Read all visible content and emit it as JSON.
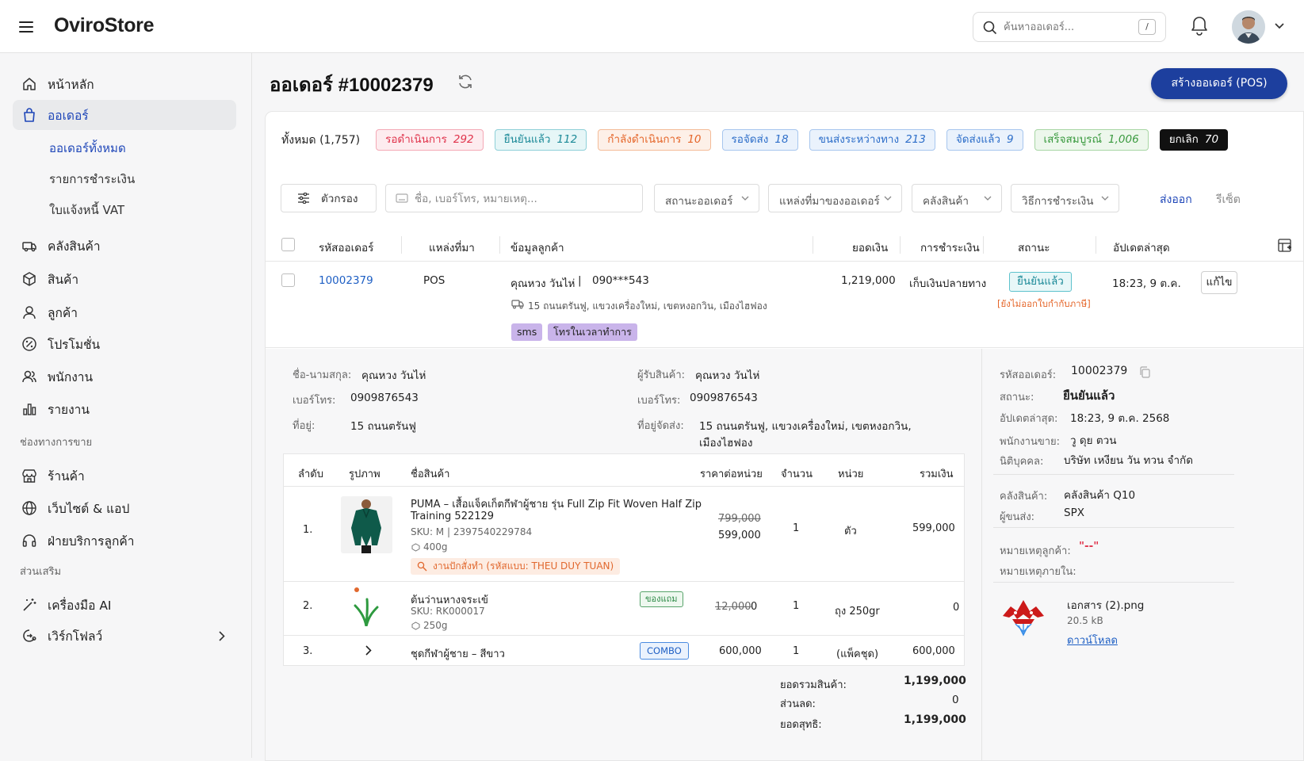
{
  "app": {
    "name": "OviroStore"
  },
  "search": {
    "placeholder": "ค้นหาออเดอร์...",
    "shortcut": "/"
  },
  "sidebar": {
    "items": [
      {
        "label": "หน้าหลัก"
      },
      {
        "label": "ออเดอร์"
      },
      {
        "label": "คลังสินค้า"
      },
      {
        "label": "สินค้า"
      },
      {
        "label": "ลูกค้า"
      },
      {
        "label": "โปรโมชั่น"
      },
      {
        "label": "พนักงาน"
      },
      {
        "label": "รายงาน"
      }
    ],
    "sub_items": [
      {
        "label": "ออเดอร์ทั้งหมด"
      },
      {
        "label": "รายการชำระเงิน"
      },
      {
        "label": "ใบแจ้งหนี้ VAT"
      }
    ],
    "sales_section": "ช่องทางการขาย",
    "sales_items": [
      {
        "label": "ร้านค้า"
      },
      {
        "label": "เว็บไซต์ & แอป"
      },
      {
        "label": "ฝ่ายบริการลูกค้า"
      }
    ],
    "addon_section": "ส่วนเสริม",
    "addon_items": [
      {
        "label": "เครื่องมือ AI"
      },
      {
        "label": "เวิร์กโฟลว์"
      }
    ]
  },
  "page": {
    "title": "ออเดอร์ #10002379",
    "create_button": "สร้างออเดอร์ (POS)"
  },
  "status_tabs": {
    "all_label": "ทั้งหมด (1,757)",
    "tabs": [
      {
        "label": "รอดำเนินการ",
        "count": "292",
        "color": "#e0344c",
        "bg": "#fdecef"
      },
      {
        "label": "ยืนยันแล้ว",
        "count": "112",
        "color": "#1c8a98",
        "bg": "#e6f6f7"
      },
      {
        "label": "กำลังดำเนินการ",
        "count": "10",
        "color": "#e5662a",
        "bg": "#fdf0e8"
      },
      {
        "label": "รอจัดส่ง",
        "count": "18",
        "color": "#2d6ec9",
        "bg": "#eaf2fc"
      },
      {
        "label": "ขนส่งระหว่างทาง",
        "count": "213",
        "color": "#2d6ec9",
        "bg": "#eaf2fc"
      },
      {
        "label": "จัดส่งแล้ว",
        "count": "9",
        "color": "#2d6ec9",
        "bg": "#eaf2fc"
      },
      {
        "label": "เสร็จสมบูรณ์",
        "count": "1,006",
        "color": "#3a9a3f",
        "bg": "#edf7ec"
      },
      {
        "label": "ยกเลิก",
        "count": "70",
        "color": "#ffffff",
        "bg": "#111111"
      }
    ]
  },
  "filters": {
    "filter_button": "ตัวกรอง",
    "search_placeholder": "ชื่อ, เบอร์โทร, หมายเหตุ...",
    "order_status": "สถานะออเดอร์",
    "order_source": "แหล่งที่มาของออเดอร์",
    "warehouse": "คลังสินค้า",
    "payment_method": "วิธีการชำระเงิน",
    "export": "ส่งออก",
    "reset": "รีเซ็ต"
  },
  "table": {
    "headers": {
      "order_id": "รหัสออเดอร์",
      "source": "แหล่งที่มา",
      "customer": "ข้อมูลลูกค้า",
      "amount": "ยอดเงิน",
      "payment": "การชำระเงิน",
      "status": "สถานะ",
      "updated": "อัปเดตล่าสุด"
    },
    "row": {
      "order_id": "10002379",
      "source": "POS",
      "customer_name": "คุณหวง วันไห่",
      "customer_phone": "090***543",
      "address": "15 ถนนตรันฟู, แขวงเครื่องใหม่, เขตหงอกวิน, เมืองไฮฟอง",
      "tags": [
        "sms",
        "โทรในเวลาทำการ"
      ],
      "amount": "1,219,000",
      "payment": "เก็บเงินปลายทาง",
      "status": "ยืนยันแล้ว",
      "tax_note": "[ยังไม่ออกใบกำกับภาษี]",
      "updated": "18:23, 9 ต.ค.",
      "edit_button": "แก้ไข"
    }
  },
  "detail": {
    "customer": {
      "name_label": "ชื่อ-นามสกุล:",
      "name": "คุณหวง วันไห่",
      "phone_label": "เบอร์โทร:",
      "phone": "0909876543",
      "address_label": "ที่อยู่:",
      "address": "15 ถนนตรันฟู"
    },
    "receiver": {
      "name_label": "ผู้รับสินค้า:",
      "name": "คุณหวง วันไห่",
      "phone_label": "เบอร์โทร:",
      "phone": "0909876543",
      "address_label": "ที่อยู่จัดส่ง:",
      "address_line1": "15 ถนนตรันฟู, แขวงเครื่องใหม่, เขตหงอกวิน,",
      "address_line2": "เมืองไฮฟอง"
    },
    "products": {
      "headers": {
        "no": "ลำดับ",
        "image": "รูปภาพ",
        "name": "ชื่อสินค้า",
        "unit_price": "ราคาต่อหน่วย",
        "qty": "จำนวน",
        "unit": "หน่วย",
        "total": "รวมเงิน"
      },
      "rows": [
        {
          "no": "1.",
          "name_line1": "PUMA – เสื้อแจ็คเก็ตกีฬาผู้ชาย รุ่น Full Zip Fit Woven Half Zip",
          "name_line2": "Training 522129",
          "sku": "SKU:  M  |  2397540229784",
          "weight": "400g",
          "embroidery": "งานปักสั่งทำ (รหัสแบบ: THEU DUY TUAN)",
          "old_price": "799,000",
          "price": "599,000",
          "qty": "1",
          "unit": "ตัว",
          "total": "599,000"
        },
        {
          "no": "2.",
          "name": "ต้นว่านหางจระเข้",
          "sku": "SKU:  RK000017",
          "weight": "250g",
          "gift_tag": "ของแถม",
          "old_price": "12,000",
          "price": "0",
          "qty": "1",
          "unit": "ถุง 250gr",
          "total": "0"
        },
        {
          "no": "3.",
          "name": "ชุดกีฬาผู้ชาย – สีขาว",
          "combo_tag": "COMBO",
          "price": "600,000",
          "qty": "1",
          "unit": "(แพ็คชุด)",
          "total": "600,000"
        }
      ]
    },
    "summary": {
      "subtotal_label": "ยอดรวมสินค้า:",
      "subtotal": "1,199,000",
      "discount_label": "ส่วนลด:",
      "discount": "0",
      "net_label": "ยอดสุทธิ:",
      "net": "1,199,000"
    },
    "side": {
      "order_id_label": "รหัสออเดอร์:",
      "order_id": "10002379",
      "status_label": "สถานะ:",
      "status": "ยืนยันแล้ว",
      "updated_label": "อัปเดตล่าสุด:",
      "updated": "18:23, 9 ต.ค. 2568",
      "staff_label": "พนักงานขาย:",
      "staff": "วู ดุย ตวน",
      "company_label": "นิติบุคคล:",
      "company": "บริษัท เหงียน วัน ทวน จำกัด",
      "warehouse_label": "คลังสินค้า:",
      "warehouse": "คลังสินค้า Q10",
      "carrier_label": "ผู้ขนส่ง:",
      "carrier": "SPX",
      "customer_note_label": "หมายเหตุลูกค้า:",
      "customer_note": "\"--\"",
      "internal_note_label": "หมายเหตุภายใน:",
      "file_name": "เอกสาร (2).png",
      "file_size": "20.5 kB",
      "download": "ดาวน์โหลด"
    }
  }
}
